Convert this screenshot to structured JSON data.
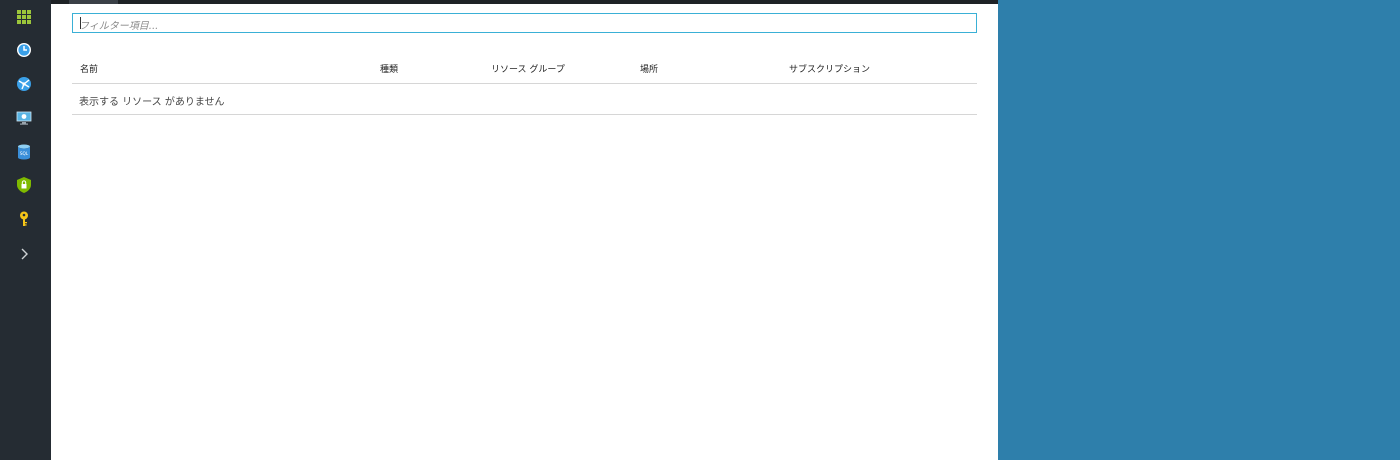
{
  "sidebar": {
    "items": [
      {
        "icon": "apps-grid-icon",
        "color": "#9cc63b"
      },
      {
        "icon": "clock-icon",
        "color": "#3aa0e8"
      },
      {
        "icon": "globe-network-icon",
        "color": "#3aa0e8"
      },
      {
        "icon": "virtual-machine-icon",
        "color": "#59b4e3"
      },
      {
        "icon": "sql-database-icon",
        "color": "#3a8fd9"
      },
      {
        "icon": "security-shield-icon",
        "color": "#7fba00"
      },
      {
        "icon": "key-icon",
        "color": "#f5c518"
      },
      {
        "icon": "chevron-right-icon",
        "color": "#cfd3d6"
      }
    ]
  },
  "filter": {
    "placeholder": "フィルター項目..."
  },
  "table": {
    "columns": [
      "名前",
      "種類",
      "リソース グループ",
      "場所",
      "サブスクリプション"
    ],
    "empty_message": "表示する リソース がありません"
  },
  "colors": {
    "sidebar_bg": "#252c33",
    "desktop_bg": "#2e7fab",
    "filter_border": "#3ab0d6"
  }
}
